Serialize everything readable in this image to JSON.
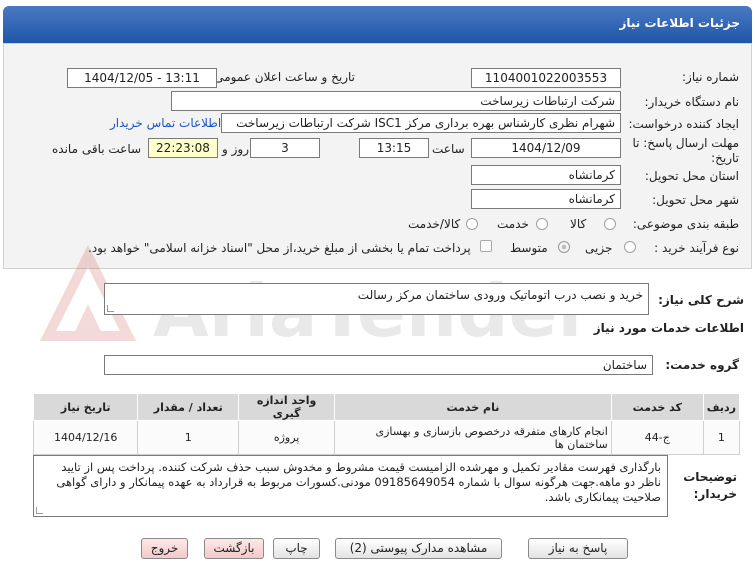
{
  "header": {
    "title": "جزئیات اطلاعات نیاز"
  },
  "form": {
    "need_number_label": "شماره نیاز:",
    "need_number": "1104001022003553",
    "announce_label": "تاریخ و ساعت اعلان عمومی:",
    "announce_value": "1404/12/05 - 13:11",
    "buyer_org_label": "نام دستگاه خریدار:",
    "buyer_org": "شرکت ارتباطات زیرساخت",
    "creator_label": "ایجاد کننده درخواست:",
    "creator": "شهرام نظری کارشناس بهره برداری مرکز ISC1 شرکت ارتباطات زیرساخت",
    "contact_link": "اطلاعات تماس خریدار",
    "deadline_label_1": "مهلت ارسال پاسخ: تا",
    "deadline_label_2": "تاریخ:",
    "deadline_date": "1404/12/09",
    "time_label": "ساعت",
    "deadline_time": "13:15",
    "days_value": "3",
    "days_label": "روز و",
    "remaining_time": "22:23:08",
    "remaining_label": "ساعت باقی مانده",
    "province_label": "استان محل تحویل:",
    "province": "کرمانشاه",
    "city_label": "شهر محل تحویل:",
    "city": "کرمانشاه",
    "category_label": "طبقه بندی موضوعی:",
    "category_options": [
      "کالا",
      "خدمت",
      "کالا/خدمت"
    ],
    "process_label": "نوع فرآیند خرید :",
    "process_options": [
      "جزیی",
      "متوسط"
    ],
    "payment_note": "پرداخت تمام یا بخشی از مبلغ خرید،از محل \"اسناد خزانه اسلامی\" خواهد بود."
  },
  "summary": {
    "label": "شرح کلی نیاز:",
    "value": "خرید و نصب درب اتوماتیک ورودی ساختمان مرکز رسالت"
  },
  "services": {
    "section_title": "اطلاعات خدمات مورد نیاز",
    "group_label": "گروه خدمت:",
    "group_value": "ساختمان"
  },
  "table": {
    "headers": [
      "ردیف",
      "کد خدمت",
      "نام خدمت",
      "واحد اندازه گیری",
      "تعداد / مقدار",
      "تاریخ نیاز"
    ],
    "rows": [
      [
        "1",
        "ج-44",
        "انجام کارهای متفرقه درخصوص بازسازی و بهسازی ساختمان ها",
        "پروژه",
        "1",
        "1404/12/16"
      ]
    ]
  },
  "notes": {
    "label_1": "توضیحات",
    "label_2": "خریدار:",
    "text": "بارگذاری فهرست مقادیر تکمیل و مهرشده الزامیست  قیمت مشروط و مخدوش سبب حذف شرکت کنندە. پرداخت پس از تایید ناظر دو ماهه.جهت هرگونه سوال با شماره 09185649054  مودنی.کسورات مربوط به قرارداد به عهدە پیمانکار و  دارای گواهی صلاحیت پیمانکاری باشد."
  },
  "buttons": {
    "reply": "پاسخ به نیاز",
    "view_docs": "مشاهده مدارک پیوستی (2)",
    "print": "چاپ",
    "back": "بازگشت",
    "exit": "خروج"
  },
  "watermark": {
    "text": "AriaTender.net"
  },
  "colors": {
    "header": "#2a5fb0",
    "link": "#1a55c8",
    "remaining_bg": "#ffffcc"
  }
}
